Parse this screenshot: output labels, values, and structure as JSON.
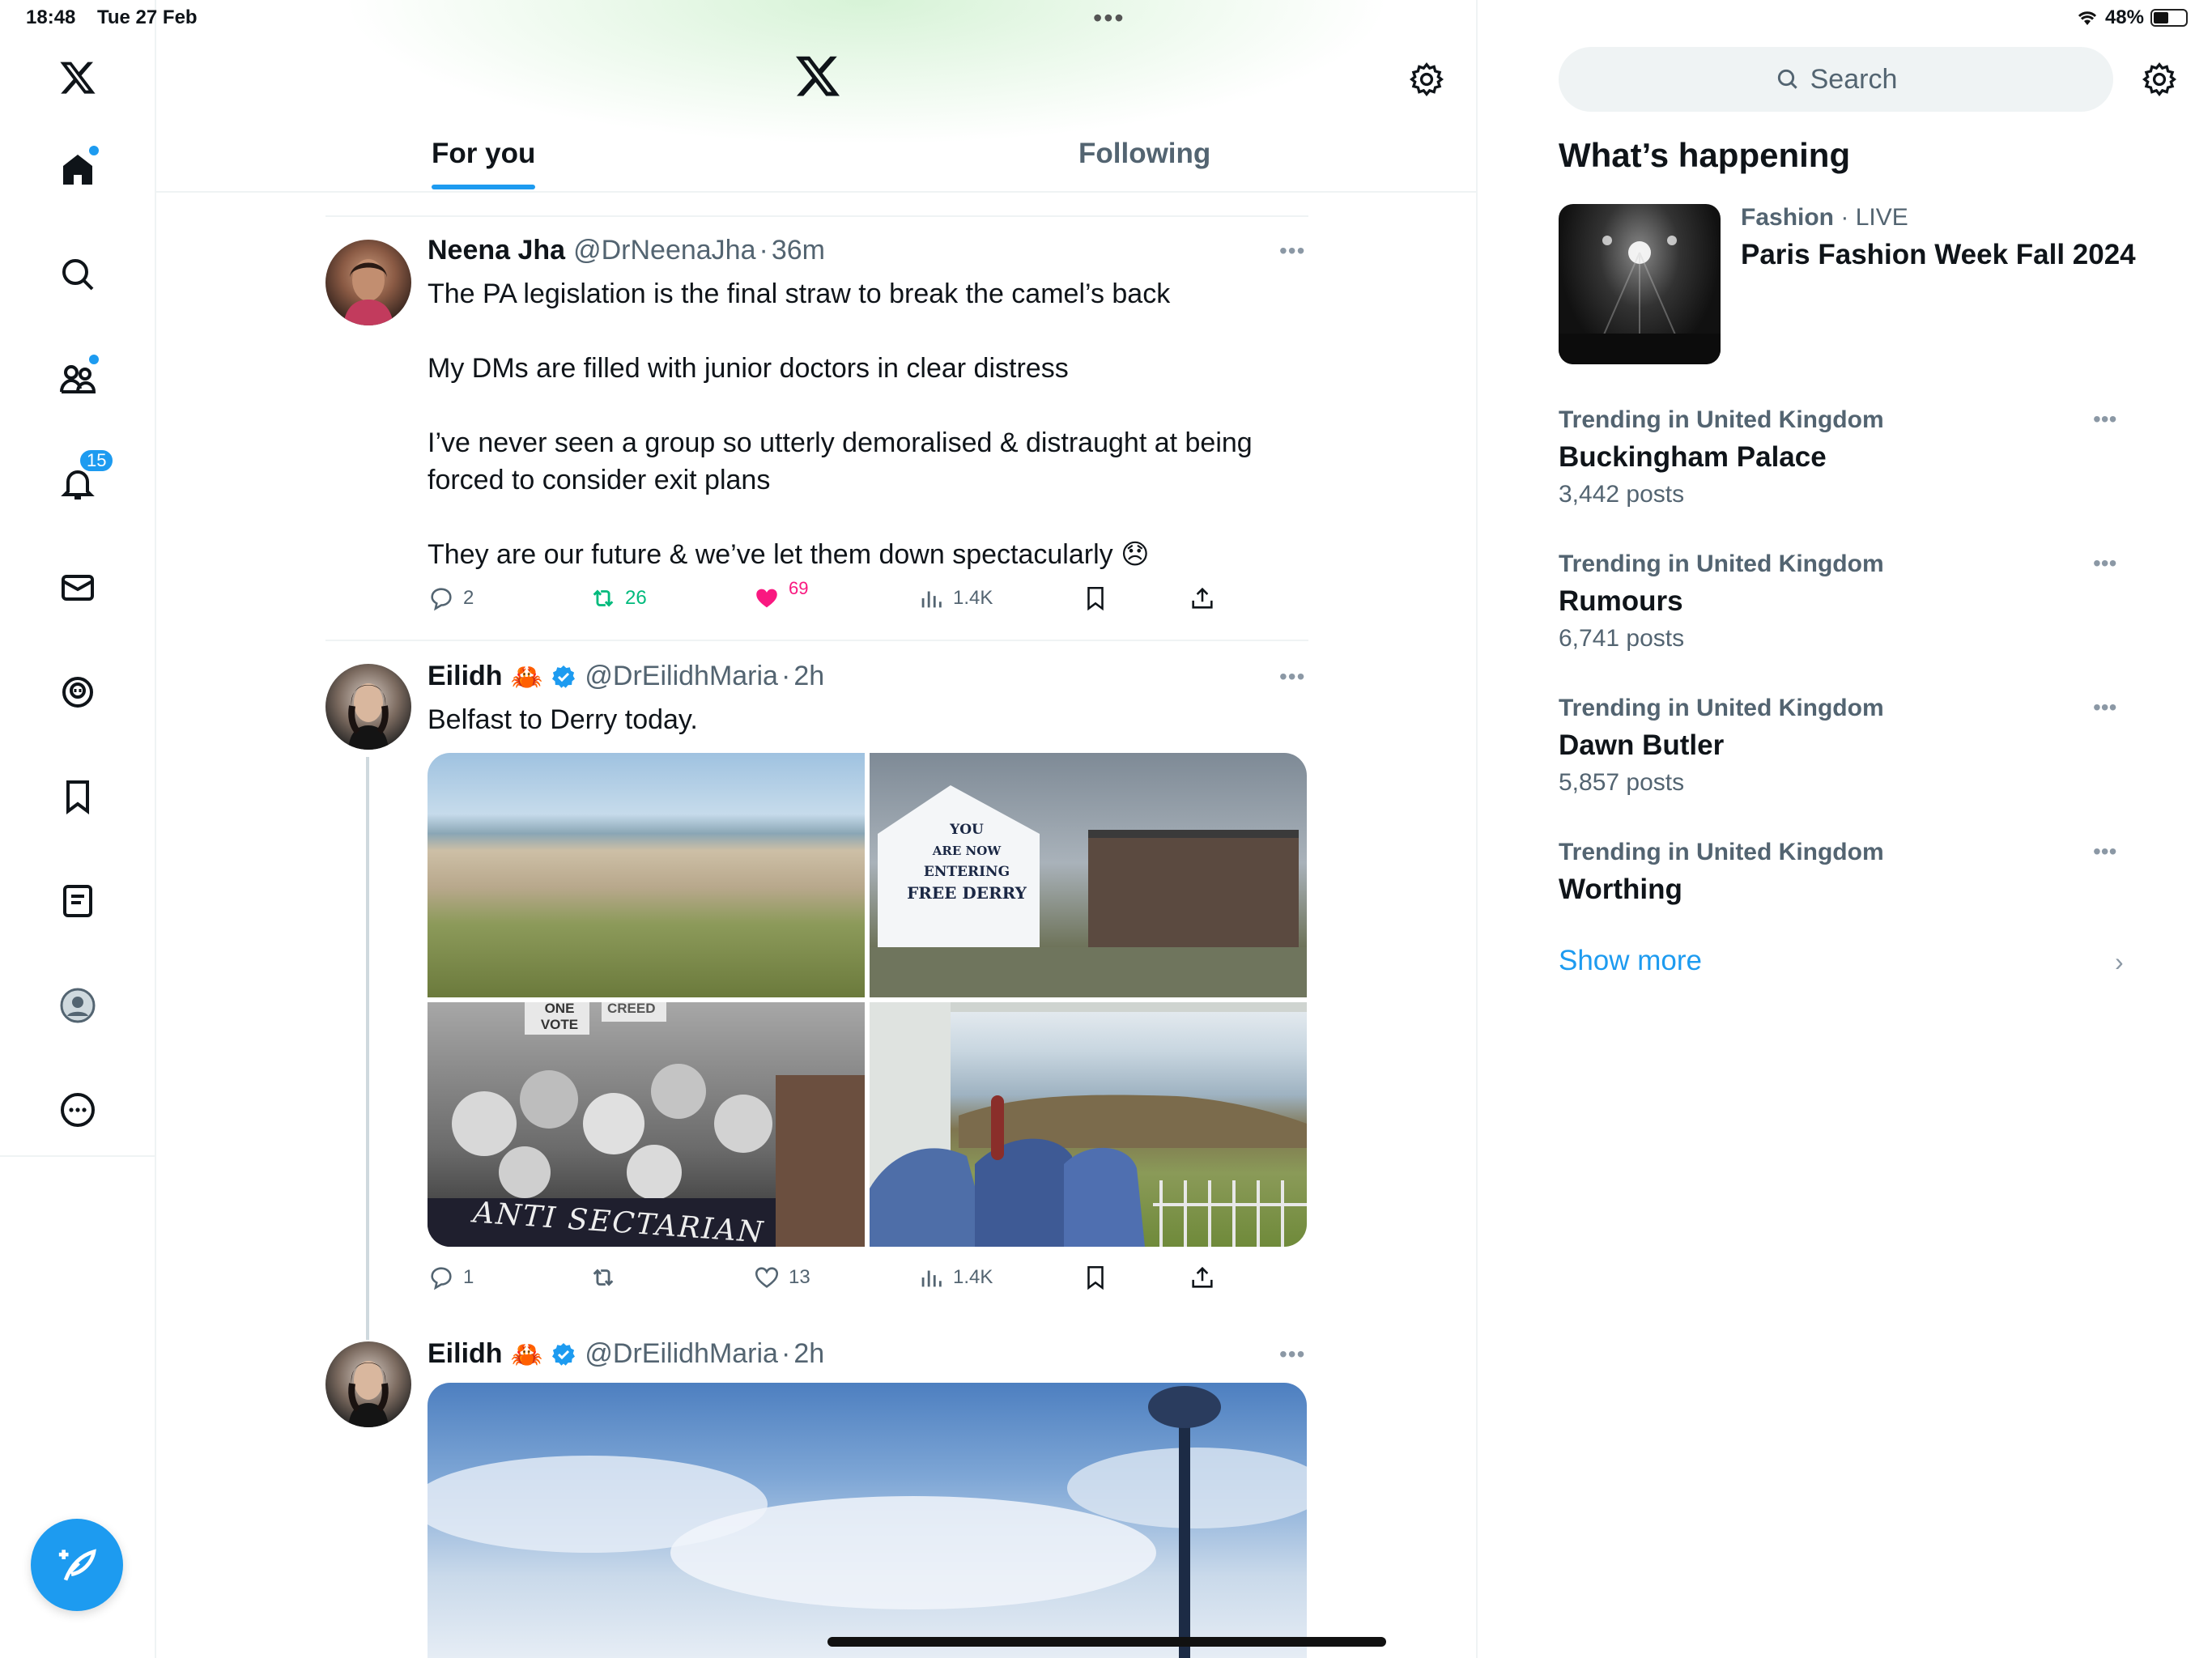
{
  "status_bar": {
    "time": "18:48",
    "date": "Tue 27 Feb",
    "battery": "48%",
    "battery_level": 0.48
  },
  "nav": {
    "notifications_badge": "15",
    "items": [
      "home-icon",
      "search-icon",
      "communities-icon",
      "notifications-icon",
      "messages-icon",
      "spaces-icon",
      "bookmarks-icon",
      "lists-icon",
      "profile-icon",
      "more-icon"
    ]
  },
  "header": {
    "tabs": [
      "For you",
      "Following"
    ],
    "active_tab": "For you"
  },
  "tweets": [
    {
      "name": "Neena Jha",
      "handle": "@DrNeenaJha",
      "time": "36m",
      "text": [
        "The PA legislation is the final straw to break the camel’s back",
        "My DMs are filled with junior doctors in clear distress",
        "I’ve never seen a group so utterly demoralised & distraught at being forced to consider exit plans",
        "They are our future & we’ve let them down spectacularly 😞"
      ],
      "replies": "2",
      "retweets": "26",
      "likes": "69",
      "views": "1.4K"
    },
    {
      "name": "Eilidh",
      "emoji": "🦀",
      "verified": true,
      "handle": "@DrEilidhMaria",
      "time": "2h",
      "text": [
        "Belfast to Derry today."
      ],
      "image_text": {
        "mural_sign": [
          "YOU",
          "ARE NOW",
          "ENTERING",
          "FREE DERRY"
        ],
        "mural_banner": "ANTI SECTARIAN",
        "mural_signs": [
          "ONE",
          "VOTE",
          "CREED"
        ]
      },
      "replies": "1",
      "retweets": "",
      "likes": "13",
      "views": "1.4K"
    },
    {
      "name": "Eilidh",
      "emoji": "🦀",
      "verified": true,
      "handle": "@DrEilidhMaria",
      "time": "2h"
    }
  ],
  "sidebar": {
    "search_placeholder": "Search",
    "section_title": "What’s happening",
    "featured": {
      "category": "Fashion",
      "status": "LIVE",
      "title": "Paris Fashion Week Fall 2024"
    },
    "trends": [
      {
        "context": "Trending in United Kingdom",
        "title": "Buckingham Palace",
        "count": "3,442 posts"
      },
      {
        "context": "Trending in United Kingdom",
        "title": "Rumours",
        "count": "6,741 posts"
      },
      {
        "context": "Trending in United Kingdom",
        "title": "Dawn Butler",
        "count": "5,857 posts"
      },
      {
        "context": "Trending in United Kingdom",
        "title": "Worthing",
        "count": ""
      }
    ],
    "show_more": "Show more"
  },
  "colors": {
    "accent": "#1d9bf0",
    "like_pink": "#f91880",
    "retweet_green": "#00ba7c",
    "secondary_text": "#536471"
  }
}
